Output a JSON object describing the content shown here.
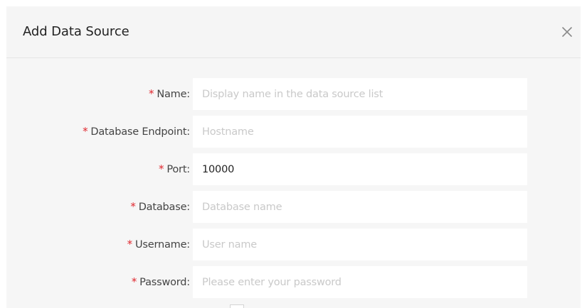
{
  "dialog": {
    "title": "Add Data Source",
    "close_icon": "close-icon"
  },
  "form": {
    "required_marker": "*",
    "fields": [
      {
        "label": "Name:",
        "value": "",
        "placeholder": "Display name in the data source list"
      },
      {
        "label": "Database Endpoint:",
        "value": "",
        "placeholder": "Hostname"
      },
      {
        "label": "Port:",
        "value": "10000",
        "placeholder": ""
      },
      {
        "label": "Database:",
        "value": "",
        "placeholder": "Database name"
      },
      {
        "label": "Username:",
        "value": "",
        "placeholder": "User name"
      },
      {
        "label": "Password:",
        "value": "",
        "placeholder": "Please enter your password"
      }
    ]
  },
  "colors": {
    "required": "#e0282f",
    "label": "#444444",
    "placeholder": "#c9c9c9",
    "background": "#f6f6f6"
  }
}
